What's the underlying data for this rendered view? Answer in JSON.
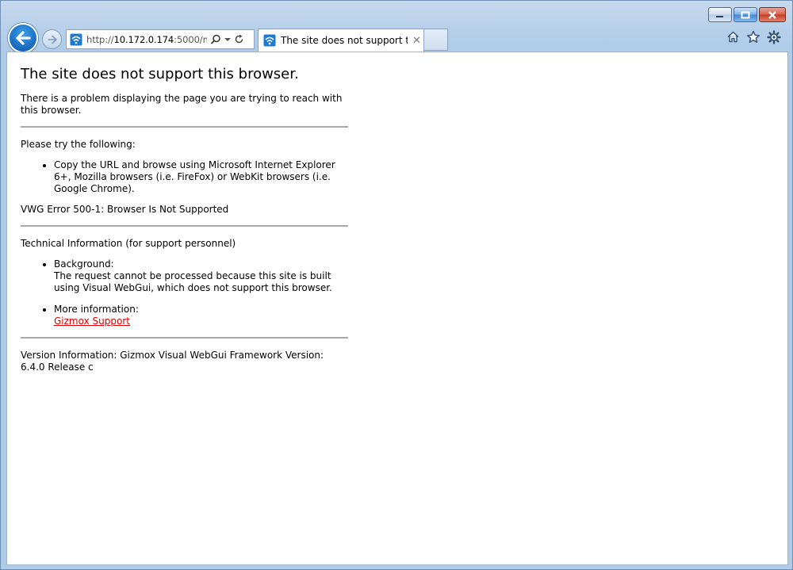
{
  "browser": {
    "address": {
      "scheme": "http://",
      "host": "10.172.0.174",
      "rest": ":5000/ma"
    },
    "tab": {
      "title": "The site does not support t..."
    },
    "icons": {
      "back": "back-arrow-icon",
      "forward": "forward-arrow-icon",
      "site": "site-wifi-icon",
      "search": "search-icon",
      "dropdown": "chevron-down-icon",
      "refresh": "refresh-icon",
      "tab_close": "close-icon",
      "home": "home-icon",
      "favorites": "star-icon",
      "tools": "gear-icon",
      "minimize": "minimize-icon",
      "maximize": "maximize-icon",
      "close": "close-window-icon"
    },
    "tab_close_glyph": "✕"
  },
  "page": {
    "title": "The site does not support this browser.",
    "intro": "There is a problem displaying the page you are trying to reach with this browser.",
    "try_heading": "Please try the following:",
    "try_items": [
      "Copy the URL and browse using Microsoft Internet Explorer 6+, Mozilla browsers (i.e. FireFox) or WebKit browsers (i.e. Google Chrome)."
    ],
    "error_code": "VWG Error 500-1: Browser Is Not Supported",
    "tech_heading": "Technical Information (for support personnel)",
    "background_label": "Background:",
    "background_text": "The request cannot be processed because this site is built using Visual WebGui, which does not support this browser.",
    "more_info_label": "More information:",
    "more_info_link": "Gizmox Support",
    "version": "Version Information: Gizmox Visual WebGui Framework Version: 6.4.0 Release c"
  },
  "colors": {
    "link": "#e00000",
    "frame": "#b9d1ea",
    "back_button": "#1a6fc2"
  }
}
